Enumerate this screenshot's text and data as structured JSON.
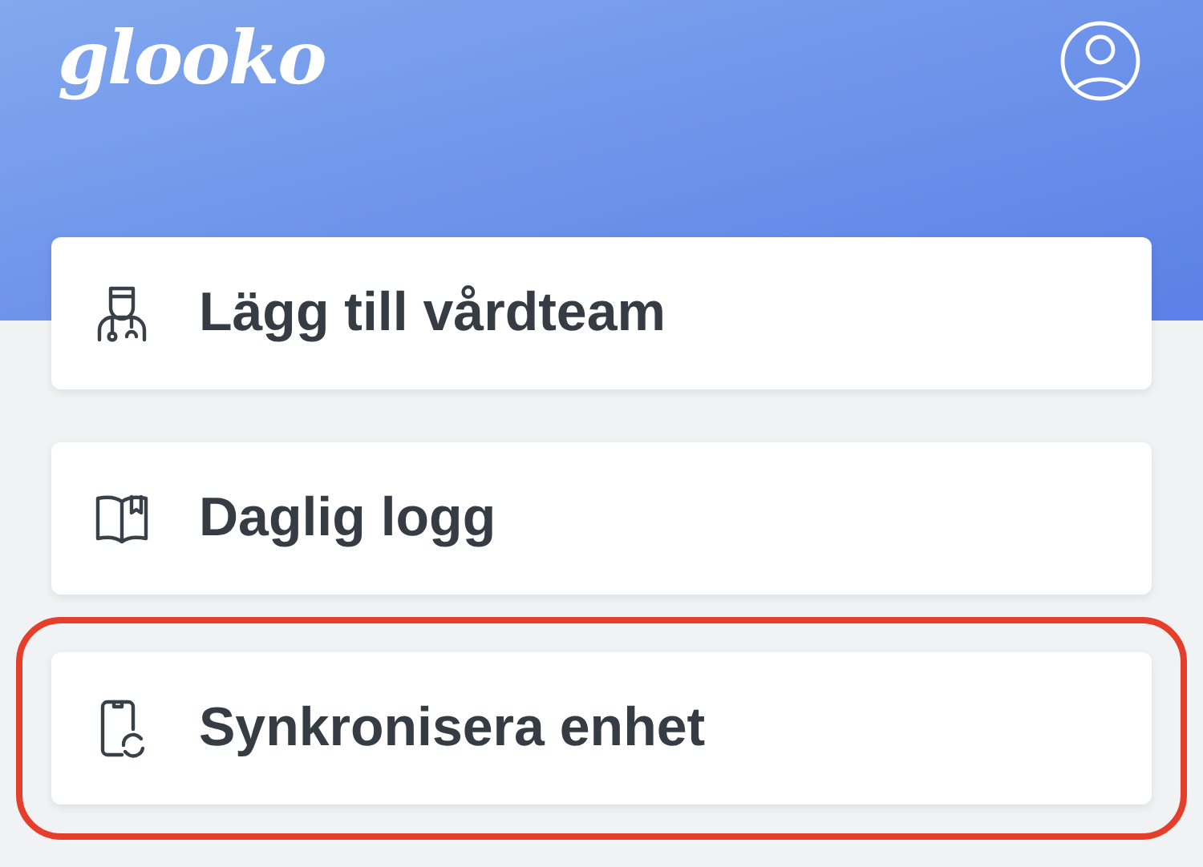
{
  "header": {
    "logo": "glooko"
  },
  "menu_items": [
    {
      "label": "Lägg till vårdteam",
      "kind": "doctor",
      "highlighted": false
    },
    {
      "label": "Daglig logg",
      "kind": "book",
      "highlighted": false
    },
    {
      "label": "Synkronisera enhet",
      "kind": "sync",
      "highlighted": true
    }
  ]
}
